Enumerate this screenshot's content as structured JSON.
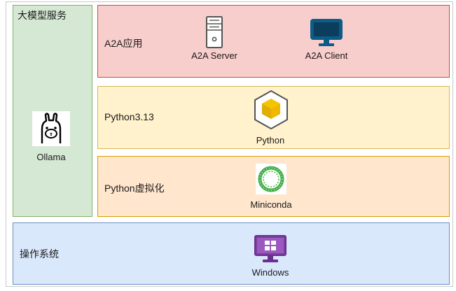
{
  "layers": {
    "llm_service": {
      "title": "大模型服务",
      "item": "Ollama"
    },
    "a2a_app": {
      "title": "A2A应用",
      "items": [
        "A2A Server",
        "A2A Client"
      ]
    },
    "python": {
      "title": "Python3.13",
      "item": "Python"
    },
    "virtualization": {
      "title": "Python虚拟化",
      "item": "Miniconda"
    },
    "os": {
      "title": "操作系统",
      "item": "Windows"
    }
  },
  "icons": {
    "ollama": "llama-icon",
    "server": "server-icon",
    "client": "monitor-icon",
    "python": "python-cube-icon",
    "miniconda": "miniconda-ring-icon",
    "windows": "windows-monitor-icon"
  },
  "colors": {
    "llm_fill": "#d5e8d4",
    "llm_stroke": "#82b366",
    "a2a_fill": "#f8cecc",
    "a2a_stroke": "#b85450",
    "python_fill": "#fff2cc",
    "python_stroke": "#d6b656",
    "venv_fill": "#ffe6cc",
    "venv_stroke": "#d79b00",
    "os_fill": "#dae8fc",
    "os_stroke": "#6c8ebf"
  }
}
